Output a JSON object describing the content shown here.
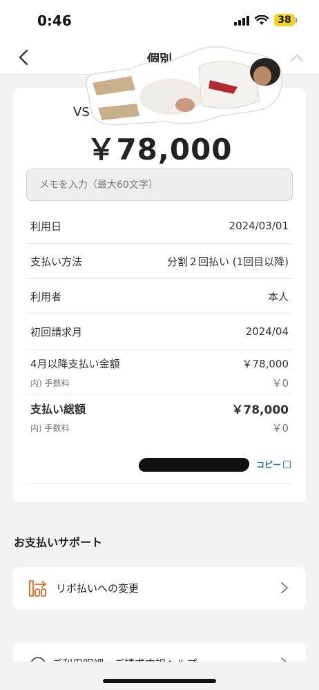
{
  "status_bar": {
    "time": "0:46",
    "battery": "38"
  },
  "nav": {
    "title": "個別"
  },
  "statement": {
    "merchant": "VS",
    "amount": "￥78,000",
    "memo_placeholder": "メモを入力（最大60文字）",
    "rows": [
      {
        "label": "利用日",
        "value": "2024/03/01"
      },
      {
        "label": "支払い方法",
        "value": "分割２回払い (1回目以降)"
      },
      {
        "label": "利用者",
        "value": "本人"
      },
      {
        "label": "初回請求月",
        "value": "2024/04"
      }
    ],
    "after_april": {
      "label": "4月以降支払い金額",
      "value": "￥78,000",
      "fee_label": "内) 手数料",
      "fee_value": "￥0"
    },
    "total": {
      "label": "支払い総額",
      "value": "￥78,000",
      "fee_label": "内) 手数料",
      "fee_value": "￥0"
    },
    "copy_label": "コピー"
  },
  "support": {
    "section_title": "お支払いサポート",
    "items": [
      {
        "label": "リボ払いへの変更"
      },
      {
        "label": "ご利用明細・ご請求内訳ヘルプ"
      }
    ]
  },
  "colors": {
    "accent_orange": "#e8732a",
    "link_blue": "#1d7fb0",
    "battery_yellow": "#f5d21b"
  }
}
